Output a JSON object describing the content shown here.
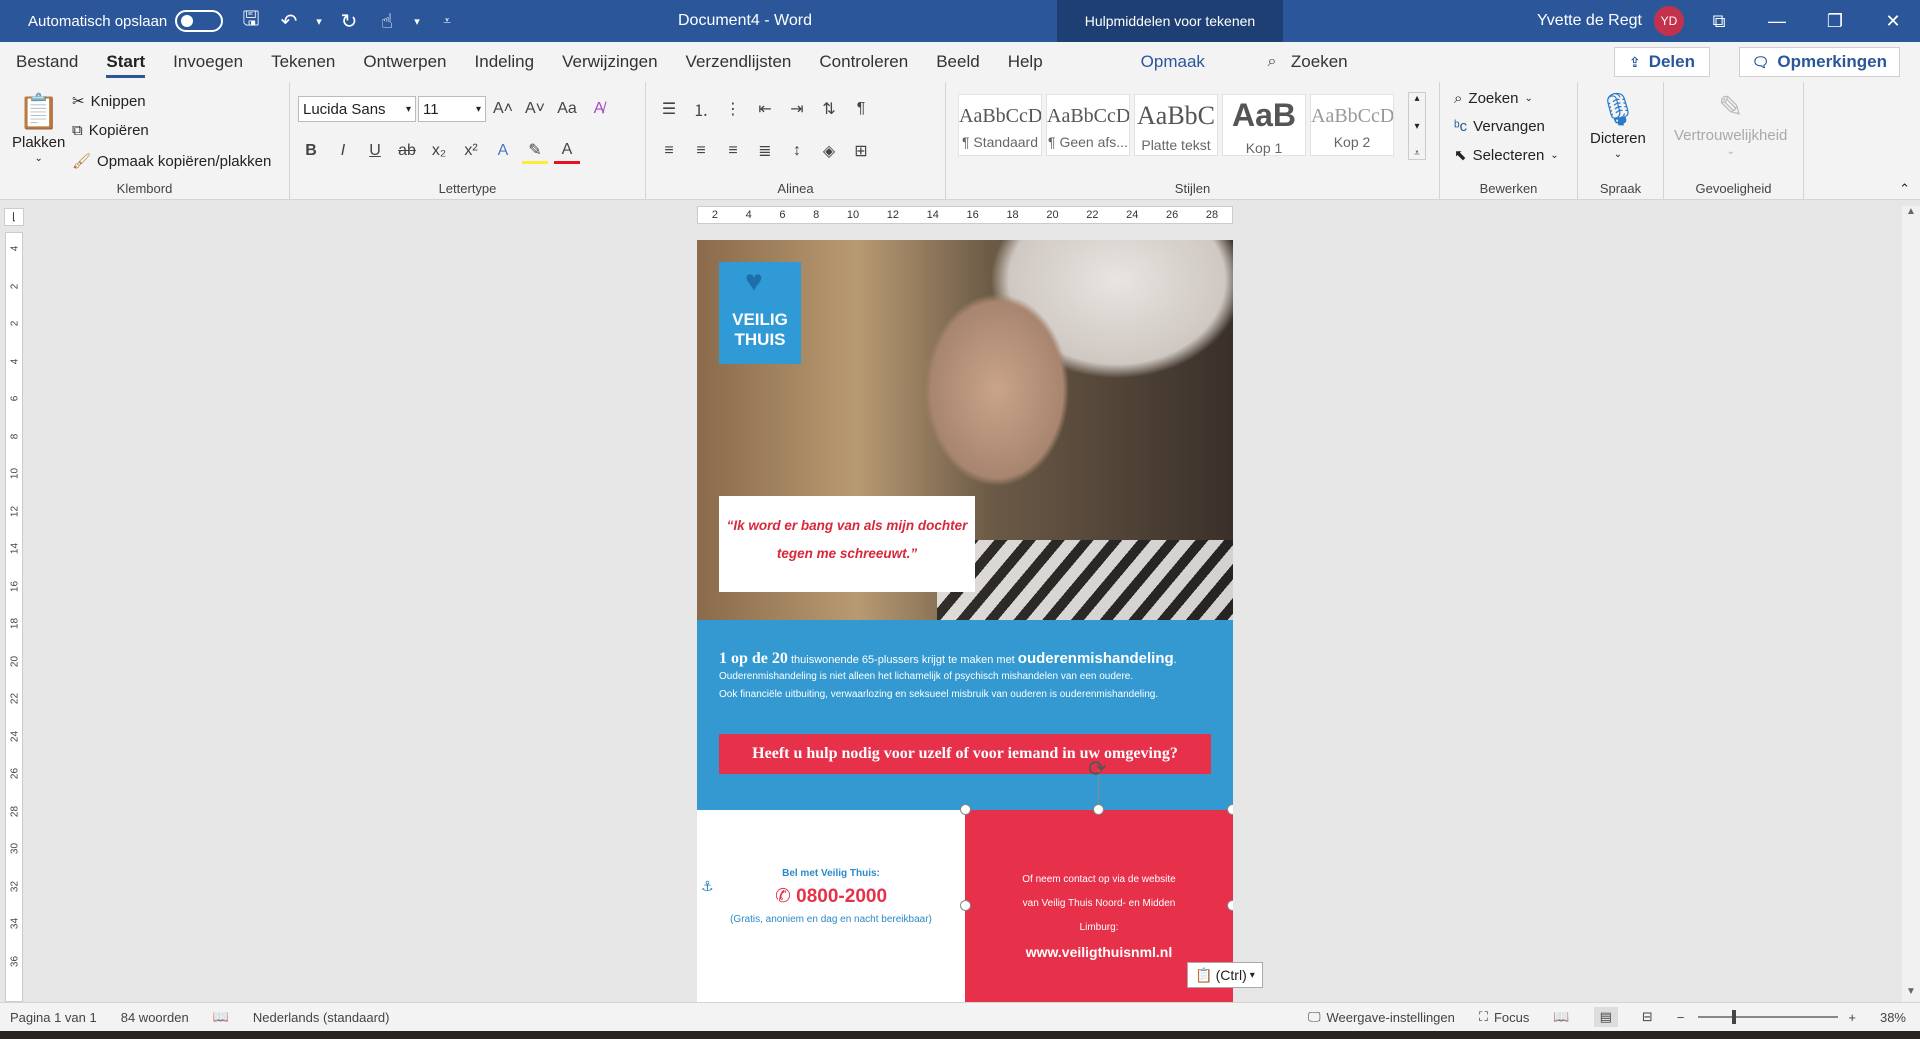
{
  "titlebar": {
    "autosave_label": "Automatisch opslaan",
    "doc_title": "Document4 - Word",
    "context_tab": "Hulpmiddelen voor tekenen",
    "user_name": "Yvette de Regt",
    "user_initials": "YD"
  },
  "tabs": [
    "Bestand",
    "Start",
    "Invoegen",
    "Tekenen",
    "Ontwerpen",
    "Indeling",
    "Verwijzingen",
    "Verzendlijsten",
    "Controleren",
    "Beeld",
    "Help"
  ],
  "active_tab": "Start",
  "context_format_tab": "Opmaak",
  "search_tab": "Zoeken",
  "share_label": "Delen",
  "comments_label": "Opmerkingen",
  "ribbon": {
    "clipboard": {
      "paste": "Plakken",
      "cut": "Knippen",
      "copy": "Kopiëren",
      "format_painter": "Opmaak kopiëren/plakken",
      "label": "Klembord"
    },
    "font": {
      "family": "Lucida Sans",
      "size": "11",
      "label": "Lettertype"
    },
    "paragraph": {
      "label": "Alinea"
    },
    "styles": {
      "label": "Stijlen",
      "items": [
        {
          "preview": "AaBbCcD",
          "name": "¶ Standaard"
        },
        {
          "preview": "AaBbCcD",
          "name": "¶ Geen afs..."
        },
        {
          "preview": "AaBbC",
          "name": "Platte tekst"
        },
        {
          "preview": "AaB",
          "name": "Kop 1"
        },
        {
          "preview": "AaBbCcD",
          "name": "Kop 2"
        }
      ]
    },
    "editing": {
      "find": "Zoeken",
      "replace": "Vervangen",
      "select": "Selecteren",
      "label": "Bewerken"
    },
    "voice": {
      "dictate": "Dicteren",
      "label": "Spraak"
    },
    "sensitivity": {
      "name": "Vertrouwelijkheid",
      "label": "Gevoeligheid"
    }
  },
  "hruler_ticks": [
    "2",
    "4",
    "6",
    "8",
    "10",
    "12",
    "14",
    "16",
    "18",
    "20",
    "22",
    "24",
    "26",
    "28"
  ],
  "vruler_ticks": [
    "4",
    "2",
    "2",
    "4",
    "6",
    "8",
    "10",
    "12",
    "14",
    "16",
    "18",
    "20",
    "22",
    "24",
    "26",
    "28",
    "30",
    "32",
    "34",
    "36"
  ],
  "document": {
    "logo_line1": "VEILIG",
    "logo_line2": "THUIS",
    "quote": "“Ik word er bang van als mijn dochter tegen me schreeuwt.”",
    "lead_big": "1 op de 20",
    "lead_mid": " thuiswonende 65-plussers krijgt te maken met ",
    "lead_bold": "ouderenmishandeling",
    "lead_end": ".",
    "line2": "Ouderenmishandeling is niet alleen het lichamelijk of psychisch mishandelen van een oudere.",
    "line3": "Ook financiële uitbuiting, verwaarlozing en seksueel misbruik van ouderen is ouderenmishandeling.",
    "cta": "Heeft u hulp nodig voor uzelf of voor iemand in uw omgeving?",
    "bel_label": "Bel met Veilig Thuis:",
    "phone": "0800-2000",
    "gratis": "(Gratis, anoniem en dag en nacht bereikbaar)",
    "contact_l1": "Of neem contact op via de website",
    "contact_l2": "van Veilig Thuis Noord- en Midden",
    "contact_l3": "Limburg:",
    "url": "www.veiligthuisnml.nl"
  },
  "paste_ctrl": "(Ctrl)",
  "statusbar": {
    "page": "Pagina 1 van 1",
    "words": "84 woorden",
    "language": "Nederlands (standaard)",
    "display_settings": "Weergave-instellingen",
    "focus": "Focus",
    "zoom": "38%"
  }
}
